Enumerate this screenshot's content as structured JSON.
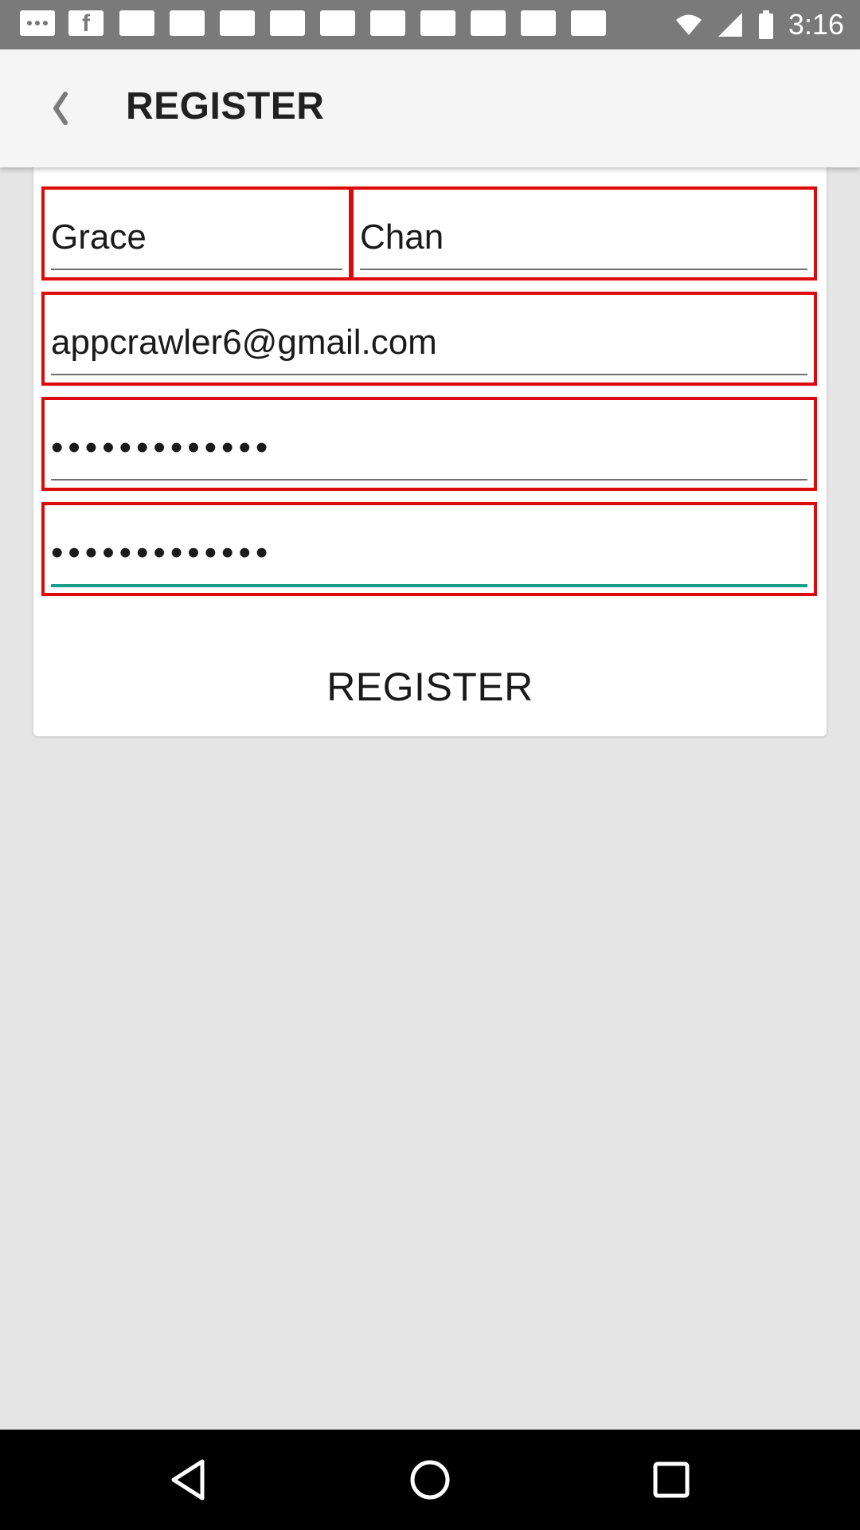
{
  "status_bar": {
    "time": "3:16",
    "notification_icons": [
      "more-icon",
      "facebook-icon",
      "notification-icon",
      "notification-icon",
      "notification-icon",
      "notification-icon",
      "notification-icon",
      "notification-icon",
      "notification-icon",
      "notification-icon",
      "notification-icon",
      "notification-icon"
    ]
  },
  "app_bar": {
    "title": "REGISTER",
    "back_icon": "chevron-left-icon"
  },
  "form": {
    "first_name": "Grace",
    "last_name": "Chan",
    "email": "appcrawler6@gmail.com",
    "password_mask": "•••••••••••••",
    "confirm_password_mask": "•••••••••••••",
    "register_label": "REGISTER"
  },
  "colors": {
    "highlight_border": "#dd0a0a",
    "focus_underline": "#1a9e8a",
    "status_bar": "#7a7a7a",
    "app_bar": "#f5f5f5",
    "background": "#e5e5e5",
    "nav_bar": "#000000"
  },
  "nav_bar": {
    "icons": [
      "back-triangle-icon",
      "home-circle-icon",
      "recents-square-icon"
    ]
  }
}
